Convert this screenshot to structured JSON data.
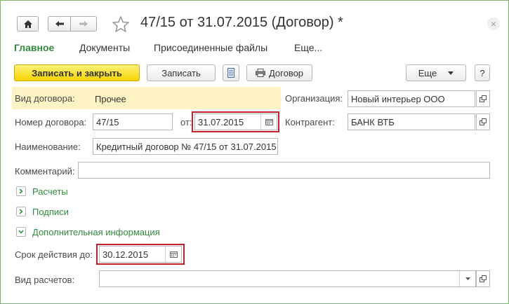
{
  "window": {
    "title": "47/15 от 31.07.2015 (Договор) *",
    "close_glyph": "×"
  },
  "tabs": [
    {
      "label": "Главное",
      "active": true
    },
    {
      "label": "Документы",
      "active": false
    },
    {
      "label": "Присоединенные файлы",
      "active": false
    },
    {
      "label": "Еще...",
      "active": false
    }
  ],
  "toolbar": {
    "save_close_label": "Записать и закрыть",
    "save_label": "Записать",
    "print_label": "Договор",
    "more_label": "Еще",
    "help_label": "?"
  },
  "form": {
    "contract_type": {
      "label": "Вид договора:",
      "value": "Прочее"
    },
    "organization": {
      "label": "Организация:",
      "value": "Новый интерьер ООО"
    },
    "contract_number": {
      "label": "Номер договора:",
      "value": "47/15"
    },
    "date": {
      "label": "от:",
      "value": "31.07.2015"
    },
    "counterparty": {
      "label": "Контрагент:",
      "value": "БАНК ВТБ"
    },
    "name": {
      "label": "Наименование:",
      "value": "Кредитный договор № 47/15 от 31.07.2015"
    },
    "comment": {
      "label": "Комментарий:",
      "value": ""
    },
    "groups": [
      {
        "label": "Расчеты",
        "expanded": false
      },
      {
        "label": "Подписи",
        "expanded": false
      },
      {
        "label": "Дополнительная информация",
        "expanded": true
      }
    ],
    "valid_until": {
      "label": "Срок действия до:",
      "value": "30.12.2015"
    },
    "settlement_type": {
      "label": "Вид расчетов:",
      "value": ""
    }
  },
  "colors": {
    "accent_green": "#2e8b3a",
    "highlight_yellow": "#fdf3c4",
    "primary_button": "#f5d400",
    "annotation_red": "#c8202a"
  }
}
